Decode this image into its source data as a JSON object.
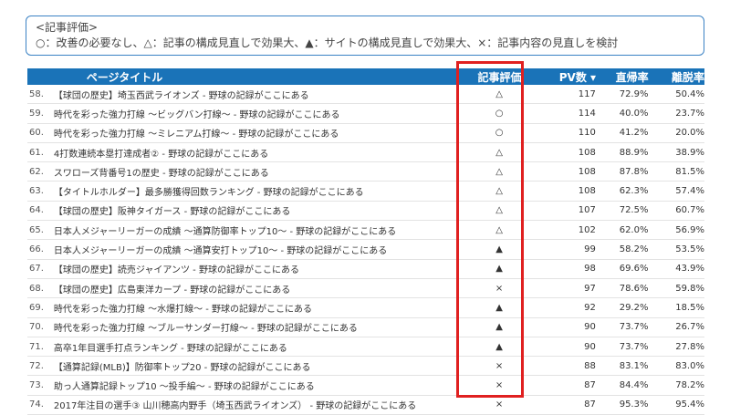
{
  "legend": {
    "title": "<記事評価>",
    "text": "○：改善の必要なし、△：記事の構成見直しで効果大、▲：サイトの構成見直しで効果大、×：記事内容の見直しを検討"
  },
  "headers": {
    "title": "ページタイトル",
    "eval": "記事評価",
    "pv": "PV数 ▾",
    "direct": "直帰率",
    "bounce": "離脱率"
  },
  "rows": [
    {
      "num": "58.",
      "title": "【球団の歴史】埼玉西武ライオンズ - 野球の記録がここにある",
      "eval": "△",
      "pv": "117",
      "direct": "72.9%",
      "bounce": "50.4%"
    },
    {
      "num": "59.",
      "title": "時代を彩った強力打線 ～ビッグバン打線～ - 野球の記録がここにある",
      "eval": "○",
      "pv": "114",
      "direct": "40.0%",
      "bounce": "23.7%"
    },
    {
      "num": "60.",
      "title": "時代を彩った強力打線 ～ミレニアム打線～ - 野球の記録がここにある",
      "eval": "○",
      "pv": "110",
      "direct": "41.2%",
      "bounce": "20.0%"
    },
    {
      "num": "61.",
      "title": "4打数連続本塁打達成者② - 野球の記録がここにある",
      "eval": "△",
      "pv": "108",
      "direct": "88.9%",
      "bounce": "38.9%"
    },
    {
      "num": "62.",
      "title": "スワローズ背番号1の歴史 - 野球の記録がここにある",
      "eval": "△",
      "pv": "108",
      "direct": "87.8%",
      "bounce": "81.5%"
    },
    {
      "num": "63.",
      "title": "【タイトルホルダー】最多勝獲得回数ランキング - 野球の記録がここにある",
      "eval": "△",
      "pv": "108",
      "direct": "62.3%",
      "bounce": "57.4%"
    },
    {
      "num": "64.",
      "title": "【球団の歴史】阪神タイガース - 野球の記録がここにある",
      "eval": "△",
      "pv": "107",
      "direct": "72.5%",
      "bounce": "60.7%"
    },
    {
      "num": "65.",
      "title": "日本人メジャーリーガーの成績 ～通算防御率トップ10～ - 野球の記録がここにある",
      "eval": "△",
      "pv": "102",
      "direct": "62.0%",
      "bounce": "56.9%"
    },
    {
      "num": "66.",
      "title": "日本人メジャーリーガーの成績 ～通算安打トップ10～ - 野球の記録がここにある",
      "eval": "▲",
      "pv": "99",
      "direct": "58.2%",
      "bounce": "53.5%"
    },
    {
      "num": "67.",
      "title": "【球団の歴史】読売ジャイアンツ - 野球の記録がここにある",
      "eval": "▲",
      "pv": "98",
      "direct": "69.6%",
      "bounce": "43.9%"
    },
    {
      "num": "68.",
      "title": "【球団の歴史】広島東洋カープ - 野球の記録がここにある",
      "eval": "×",
      "pv": "97",
      "direct": "78.6%",
      "bounce": "59.8%"
    },
    {
      "num": "69.",
      "title": "時代を彩った強力打線 ～水爆打線～ - 野球の記録がここにある",
      "eval": "▲",
      "pv": "92",
      "direct": "29.2%",
      "bounce": "18.5%"
    },
    {
      "num": "70.",
      "title": "時代を彩った強力打線 ～ブルーサンダー打線～ - 野球の記録がここにある",
      "eval": "▲",
      "pv": "90",
      "direct": "73.7%",
      "bounce": "26.7%"
    },
    {
      "num": "71.",
      "title": "高卒1年目選手打点ランキング - 野球の記録がここにある",
      "eval": "▲",
      "pv": "90",
      "direct": "73.7%",
      "bounce": "27.8%"
    },
    {
      "num": "72.",
      "title": "【通算記録(MLB)】防御率トップ20 - 野球の記録がここにある",
      "eval": "×",
      "pv": "88",
      "direct": "83.1%",
      "bounce": "83.0%"
    },
    {
      "num": "73.",
      "title": "助っ人通算記録トップ10 ～投手編～ - 野球の記録がここにある",
      "eval": "×",
      "pv": "87",
      "direct": "84.4%",
      "bounce": "78.2%"
    },
    {
      "num": "74.",
      "title": "2017年注目の選手③ 山川穂高内野手（埼玉西武ライオンズ） - 野球の記録がここにある",
      "eval": "×",
      "pv": "87",
      "direct": "95.3%",
      "bounce": "95.4%"
    }
  ]
}
